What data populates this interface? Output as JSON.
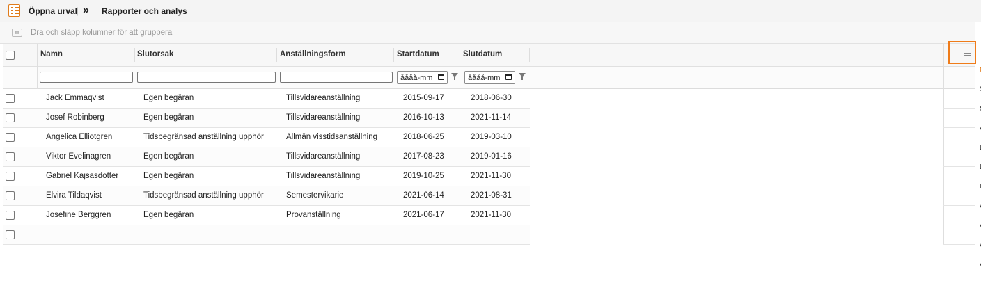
{
  "toolbar": {
    "open_selection": "Öppna urval",
    "separator": "|",
    "breadcrumb_chevron": "»",
    "title": "Rapporter och analys"
  },
  "group_panel": {
    "icon": "group-by-icon",
    "hint": "Dra och släpp kolumner för att gruppera"
  },
  "columns": [
    "Namn",
    "Slutorsak",
    "Anställningsform",
    "Startdatum",
    "Slutdatum"
  ],
  "filters": {
    "date_placeholder": "åååå-mm"
  },
  "rows": [
    {
      "namn": "Jack Emmaqvist",
      "slutorsak": "Egen begäran",
      "form": "Tillsvidareanställning",
      "start": "2015-09-17",
      "slut": "2018-06-30"
    },
    {
      "namn": "Josef Robinberg",
      "slutorsak": "Egen begäran",
      "form": "Tillsvidareanställning",
      "start": "2016-10-13",
      "slut": "2021-11-14"
    },
    {
      "namn": "Angelica Elliotgren",
      "slutorsak": "Tidsbegränsad anställning upphör",
      "form": "Allmän visstidsanställning",
      "start": "2018-06-25",
      "slut": "2019-03-10"
    },
    {
      "namn": "Viktor Evelinagren",
      "slutorsak": "Egen begäran",
      "form": "Tillsvidareanställning",
      "start": "2017-08-23",
      "slut": "2019-01-16"
    },
    {
      "namn": "Gabriel Kajsasdotter",
      "slutorsak": "Egen begäran",
      "form": "Tillsvidareanställning",
      "start": "2019-10-25",
      "slut": "2021-11-30"
    },
    {
      "namn": "Elvira Tildaqvist",
      "slutorsak": "Tidsbegränsad anställning upphör",
      "form": "Semestervikarie",
      "start": "2021-06-14",
      "slut": "2021-08-31"
    },
    {
      "namn": "Josefine Berggren",
      "slutorsak": "Egen begäran",
      "form": "Provanställning",
      "start": "2021-06-17",
      "slut": "2021-11-30"
    }
  ],
  "right_panel_letters": [
    "F",
    "S",
    "S",
    "A",
    "L",
    "L",
    "L",
    "A",
    "A",
    "A",
    "A"
  ]
}
